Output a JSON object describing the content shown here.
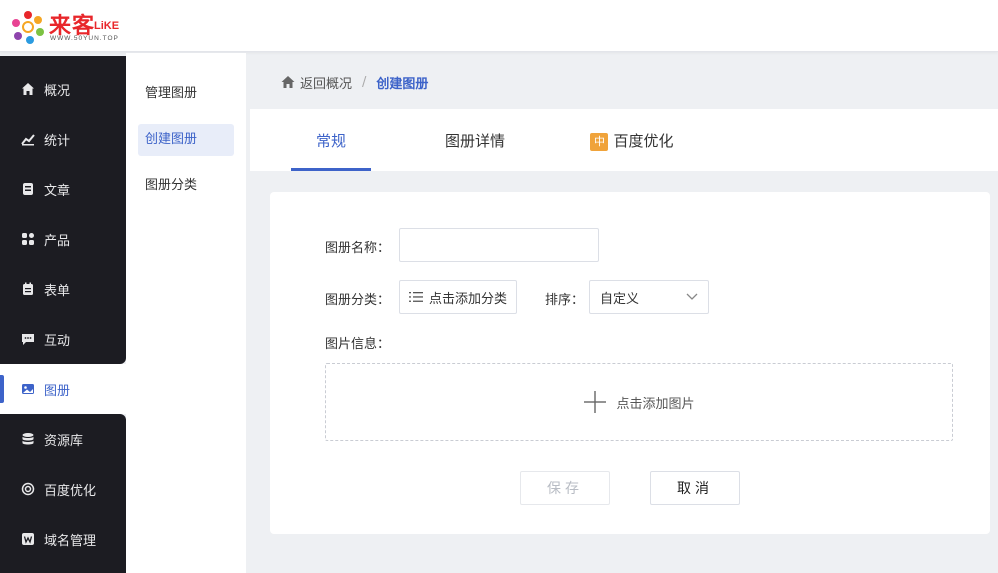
{
  "header": {
    "logo_text": "来客",
    "logo_suffix": "LiKE",
    "logo_url": "WWW.50YUN.TOP"
  },
  "nav": {
    "items": [
      {
        "label": "概况",
        "icon": "home-icon"
      },
      {
        "label": "统计",
        "icon": "chart-icon"
      },
      {
        "label": "文章",
        "icon": "article-icon"
      },
      {
        "label": "产品",
        "icon": "grid-icon"
      },
      {
        "label": "表单",
        "icon": "clipboard-icon"
      },
      {
        "label": "互动",
        "icon": "message-icon"
      },
      {
        "label": "图册",
        "icon": "image-album-icon",
        "active": true
      },
      {
        "label": "资源库",
        "icon": "database-icon"
      },
      {
        "label": "百度优化",
        "icon": "baidu-icon"
      },
      {
        "label": "域名管理",
        "icon": "domain-icon"
      }
    ]
  },
  "subnav": {
    "items": [
      {
        "label": "管理图册"
      },
      {
        "label": "创建图册",
        "active": true
      },
      {
        "label": "图册分类"
      }
    ]
  },
  "breadcrumb": {
    "back": "返回概况",
    "separator": "/",
    "current": "创建图册"
  },
  "tabs": [
    {
      "label": "常规",
      "active": true
    },
    {
      "label": "图册详情"
    },
    {
      "label": "百度优化",
      "badge": "中"
    }
  ],
  "form": {
    "name_label": "图册名称：",
    "name_value": "",
    "category_label": "图册分类：",
    "category_button": "点击添加分类",
    "sort_label": "排序：",
    "sort_value": "自定义",
    "image_label": "图片信息：",
    "add_image": "点击添加图片",
    "save": "保存",
    "cancel": "取消"
  },
  "colors": {
    "accent": "#3d63c9",
    "nav_bg": "#1c1c22",
    "badge": "#f0a33a",
    "brand_red": "#e8262a"
  }
}
